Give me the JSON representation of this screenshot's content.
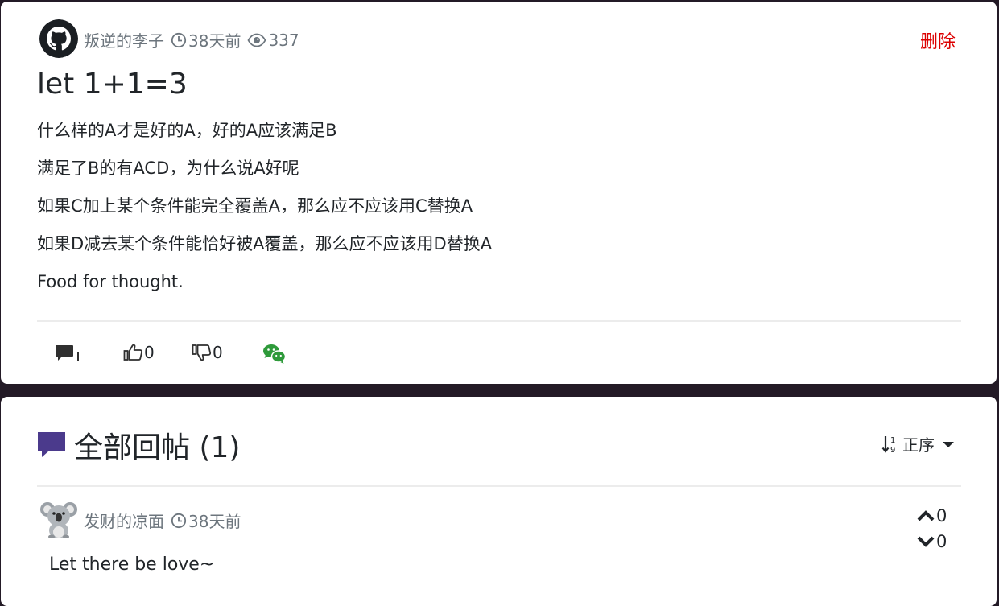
{
  "post": {
    "author": "叛逆的李子",
    "time": "38天前",
    "views": "337",
    "delete_label": "删除",
    "title": "let 1+1=3",
    "paragraphs": [
      "什么样的A才是好的A，好的A应该满足B",
      "满足了B的有ACD，为什么说A好呢",
      "如果C加上某个条件能完全覆盖A，那么应不应该用C替换A",
      "如果D减去某个条件能恰好被A覆盖，那么应不应该用D替换A",
      "Food for thought."
    ],
    "actions": {
      "comment_count": "",
      "like_count": "0",
      "dislike_count": "0"
    },
    "icons": [
      "github-avatar",
      "clock-icon",
      "eye-icon",
      "comment-icon",
      "thumbs-up-icon",
      "thumbs-down-icon",
      "wechat-icon"
    ]
  },
  "replies_section": {
    "title": "全部回帖 (1)",
    "sort_label": "正序",
    "icons": [
      "comments-icon",
      "sort-icon",
      "caret-down-icon"
    ]
  },
  "replies": [
    {
      "author": "发财的凉面",
      "time": "38天前",
      "text": "Let there be love~",
      "upvotes": "0",
      "downvotes": "0",
      "avatar": "koala-avatar"
    }
  ],
  "colors": {
    "page_background": "#231a26",
    "card_background": "#ffffff",
    "delete": "#dc0000",
    "meta_text": "#6c757d",
    "section_icon": "#4b3a8c",
    "wechat": "#2e9a3a"
  }
}
